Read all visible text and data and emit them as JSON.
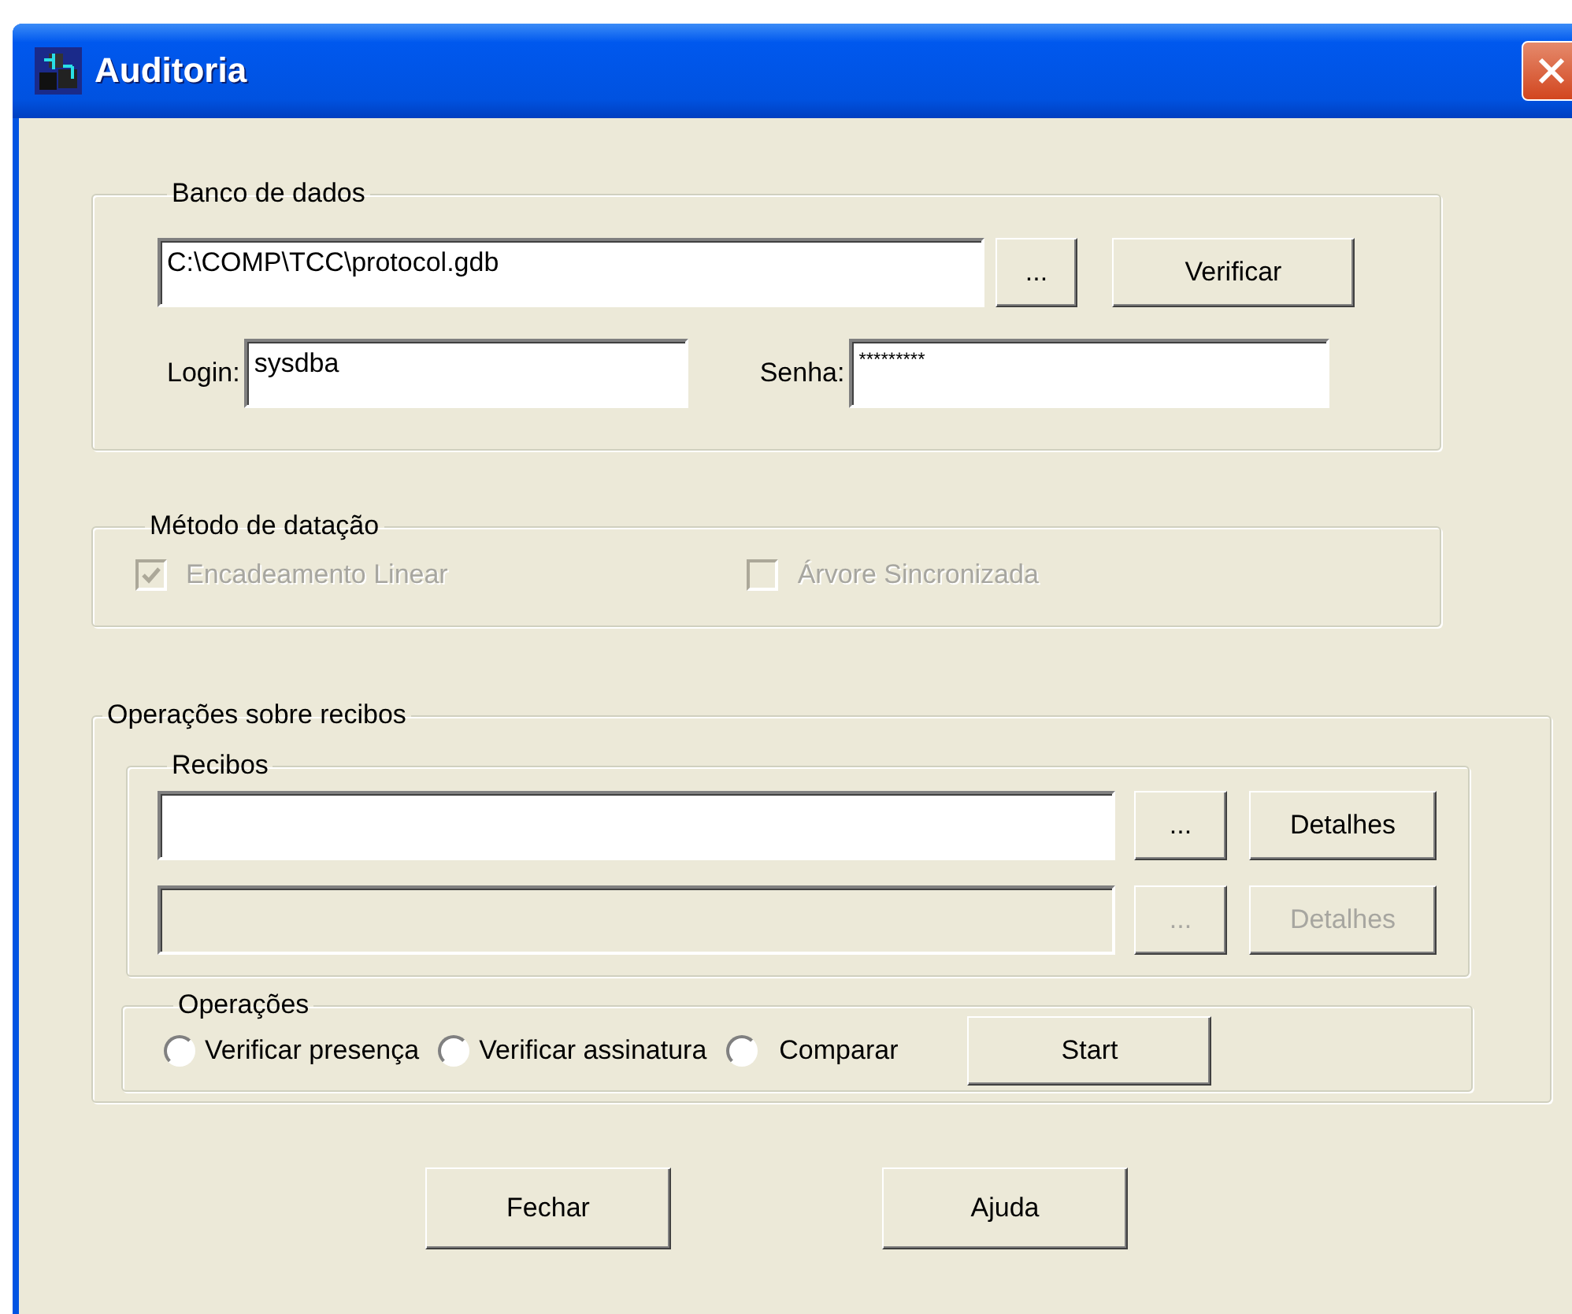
{
  "window": {
    "title": "Auditoria"
  },
  "database": {
    "legend": "Banco de dados",
    "path": "C:\\COMP\\TCC\\protocol.gdb",
    "browse_button": "...",
    "verify_button": "Verificar",
    "login_label": "Login:",
    "login": "sysdba",
    "password_label": "Senha:",
    "password": "*********"
  },
  "dating_method": {
    "legend": "Método de datação",
    "options": [
      {
        "label": "Encadeamento Linear",
        "checked": true,
        "disabled": true
      },
      {
        "label": "Árvore Sincronizada",
        "checked": false,
        "disabled": true
      }
    ]
  },
  "receipt_operations": {
    "legend": "Operações sobre recibos",
    "receipts": {
      "legend": "Recibos",
      "rows": [
        {
          "browse_button": "...",
          "details_button": "Detalhes",
          "disabled": false
        },
        {
          "browse_button": "...",
          "details_button": "Detalhes",
          "disabled": true
        }
      ]
    },
    "operations": {
      "legend": "Operações",
      "options": [
        {
          "label": "Verificar presença",
          "selected": false
        },
        {
          "label": "Verificar assinatura",
          "selected": false
        },
        {
          "label": "Comparar",
          "selected": false
        }
      ],
      "start_button": "Start"
    }
  },
  "buttons": [
    "Fechar",
    "Ajuda"
  ]
}
